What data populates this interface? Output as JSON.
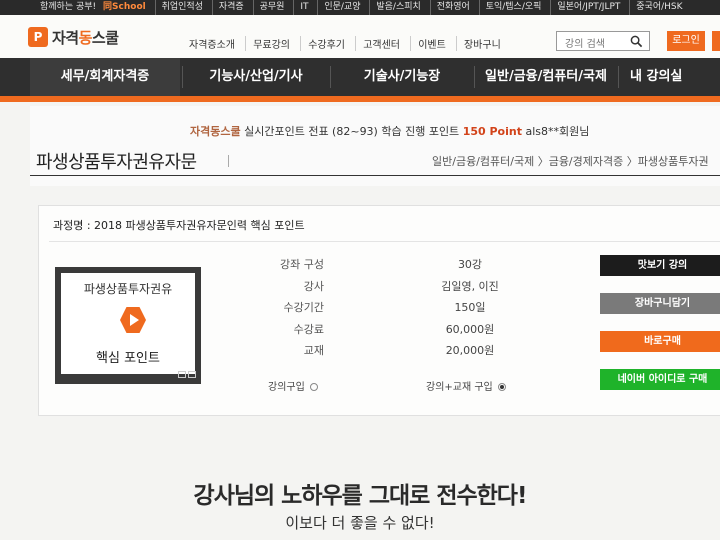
{
  "topbar": {
    "lead": "함께하는 공부!",
    "school": "同School",
    "links": [
      "취업인적성",
      "자격증",
      "공무원",
      "IT",
      "인문/교양",
      "발음/스피치",
      "전화영어",
      "토익/텝스/오픽",
      "일본어/JPT/JLPT",
      "중국어/HSK"
    ]
  },
  "header": {
    "logo_mark": "P",
    "logo_prefix": "자격",
    "logo_accent": "동",
    "logo_suffix": "스쿨",
    "nav": [
      "자격증소개",
      "무료강의",
      "수강후기",
      "고객센터",
      "이벤트",
      "장바구니"
    ],
    "search_placeholder": "강의 검색",
    "login_label": "로그인"
  },
  "main_nav": [
    "세무/회계자격증",
    "기능사/산업/기사",
    "기술사/기능장",
    "일반/금융/컴퓨터/국제",
    "내 강의실"
  ],
  "points_bar": {
    "brand": "자격동스쿨",
    "text1": " 실시간포인트 전표 (82~93) 학습 진행 포인트 ",
    "points": "150 Point",
    "text2": " als8**회원님"
  },
  "page": {
    "title": "파생상품투자권유자문",
    "breadcrumb": "일반/금융/컴퓨터/국제 〉금융/경제자격증 〉파생상품투자권"
  },
  "course": {
    "name": "과정명 : 2018 파생상품투자권유자문인력 핵심 포인트",
    "thumb_title": "파생상품투자권유",
    "thumb_subtitle": "핵심 포인트",
    "details": [
      {
        "label": "강좌 구성",
        "value": "30강"
      },
      {
        "label": "강사",
        "value": "김일영, 이진"
      },
      {
        "label": "수강기간",
        "value": "150일"
      },
      {
        "label": "수강료",
        "value": "60,000원"
      },
      {
        "label": "교재",
        "value": "20,000원"
      }
    ],
    "options": [
      {
        "label": "강의구입",
        "selected": false
      },
      {
        "label": "강의+교재 구입",
        "selected": true
      }
    ],
    "buttons": [
      "맛보기 강의",
      "장바구니담기",
      "바로구매",
      "네이버 아이디로 구매"
    ],
    "button_colors": [
      "#1c1c1c",
      "#7a7a7a",
      "#f06a1c",
      "#1fb32a"
    ]
  },
  "promo": {
    "line1": "강사님의 노하우를 그대로 전수한다!",
    "line2": "이보다 더 좋을 수 없다!"
  },
  "colors": {
    "accent": "#ef6a1f",
    "nav_bg": "#2f2f2f"
  }
}
